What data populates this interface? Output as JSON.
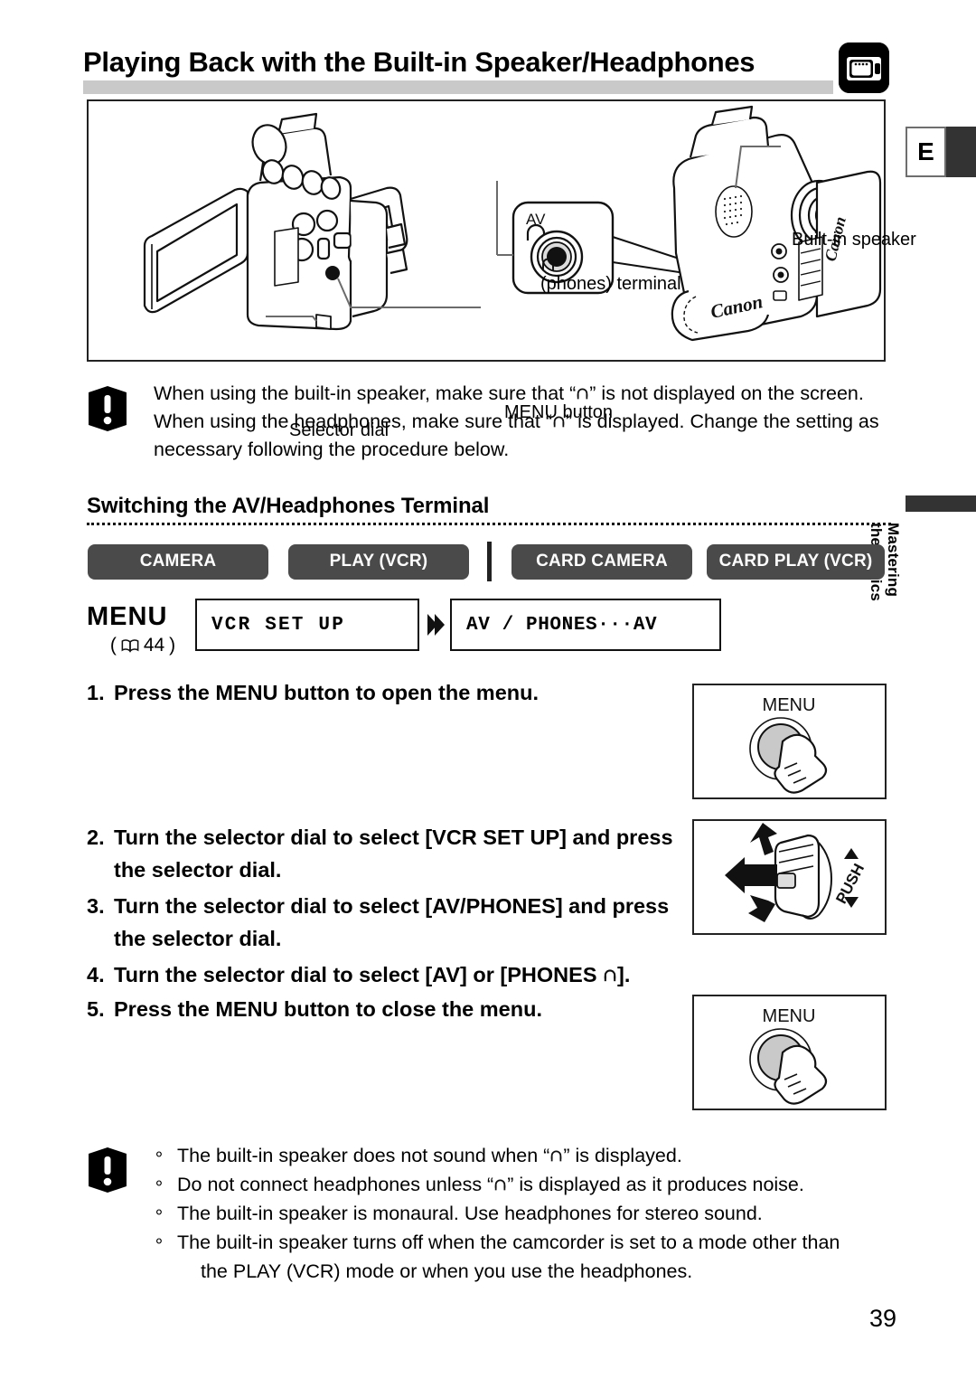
{
  "header": {
    "title": "Playing Back with the Built-in Speaker/Headphones",
    "icon": "camcorder-tape-icon",
    "lang_tab": "E"
  },
  "side_tab": {
    "label": "Mastering\nthe Basics"
  },
  "illustration": {
    "labels": {
      "built_in_speaker": "Built-in speaker",
      "phones_terminal": "(phones) terminal",
      "menu_button": "MENU button",
      "selector_dial": "Selector dial"
    },
    "jack_detail": {
      "av_label": "AV",
      "phones_symbol": "headphones-icon"
    },
    "brand": "Canon"
  },
  "caution_top": {
    "icon": "exclamation-warning-icon",
    "lines": [
      "When using the built-in speaker, make sure that “○” is not displayed on the",
      "screen. When using the headphones, make sure that “○” is displayed. Change",
      "the setting as necessary following the procedure below."
    ],
    "text_part_1": "When using the built-in speaker, make sure that “",
    "text_part_2": "” is not displayed on the screen. When using the headphones, make sure that “",
    "text_part_3": "” is displayed. Change the setting as necessary following the procedure below."
  },
  "section": {
    "heading": "Switching the AV/Headphones Terminal"
  },
  "mode_badges": [
    {
      "label": "CAMERA"
    },
    {
      "label": "PLAY (VCR)"
    },
    {
      "label": "CARD CAMERA"
    },
    {
      "label": "CARD PLAY (VCR)"
    }
  ],
  "menu_path": {
    "menu_word": "MENU",
    "page_ref": "44",
    "book_icon": "open-book-icon",
    "box1": "VCR SET UP",
    "box2": "AV / PHONES···AV",
    "arrow": "double-chevron-right-icon"
  },
  "steps": [
    {
      "num": "1.",
      "text": "Press the MENU button to open the menu."
    },
    {
      "num": "2.",
      "text": "Turn the selector dial to select [VCR SET UP] and press the selector dial."
    },
    {
      "num": "3.",
      "text": "Turn the selector dial to select [AV/PHONES] and press the selector dial."
    },
    {
      "num": "4.",
      "text_part_1": "Turn the selector dial to select [AV] or [PHONES ",
      "text_part_2": "]."
    },
    {
      "num": "5.",
      "text": "Press the MENU button to close the menu."
    }
  ],
  "illustration_boxes": [
    {
      "name": "menu-button-press",
      "label": "MENU"
    },
    {
      "name": "selector-dial-turn-push",
      "label": "PUSH"
    },
    {
      "name": "menu-button-press-close",
      "label": "MENU"
    }
  ],
  "caution_bottom": {
    "icon": "exclamation-warning-icon",
    "bullet_mark": "∘",
    "items": [
      {
        "part_1": "The built-in speaker does not sound when “",
        "part_2": "” is displayed."
      },
      {
        "part_1": "Do not connect headphones unless “",
        "part_2": "” is displayed as it produces noise."
      },
      {
        "part_1": "The built-in speaker is monaural. Use headphones for stereo sound.",
        "part_2": ""
      },
      {
        "part_1": "The built-in speaker turns off when the camcorder is set to a mode other than",
        "part_2": "",
        "cont": "the PLAY (VCR) mode or when you use the headphones."
      }
    ]
  },
  "page_number": "39"
}
